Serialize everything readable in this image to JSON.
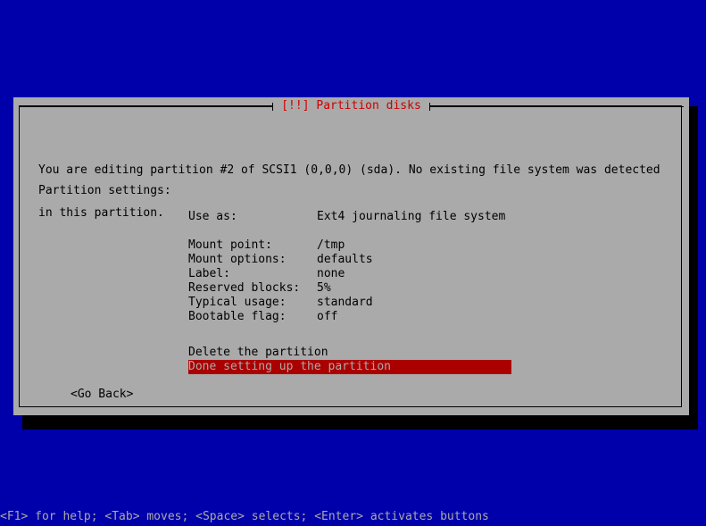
{
  "screen": {
    "background_color": "#0000aa",
    "foreground_color": "#aaaaaa"
  },
  "dialog": {
    "title": "[!!] Partition disks",
    "title_color": "#cc0000",
    "background_color": "#aaaaaa",
    "intro_line1": "You are editing partition #2 of SCSI1 (0,0,0) (sda). No existing file system was detected",
    "intro_line2": "in this partition.",
    "section_label": "Partition settings:",
    "settings": [
      {
        "label": "Use as:",
        "value": "Ext4 journaling file system"
      },
      {
        "label": "Mount point:",
        "value": "/tmp"
      },
      {
        "label": "Mount options:",
        "value": "defaults"
      },
      {
        "label": "Label:",
        "value": "none"
      },
      {
        "label": "Reserved blocks:",
        "value": "5%"
      },
      {
        "label": "Typical usage:",
        "value": "standard"
      },
      {
        "label": "Bootable flag:",
        "value": "off"
      }
    ],
    "actions": [
      {
        "label": "Delete the partition",
        "selected": false
      },
      {
        "label": "Done setting up the partition",
        "selected": true
      }
    ],
    "selected_background_color": "#aa0000",
    "selected_foreground_color": "#aaaaaa",
    "go_back_button": "<Go Back>"
  },
  "status_bar": {
    "text": "<F1> for help; <Tab> moves; <Space> selects; <Enter> activates buttons"
  }
}
